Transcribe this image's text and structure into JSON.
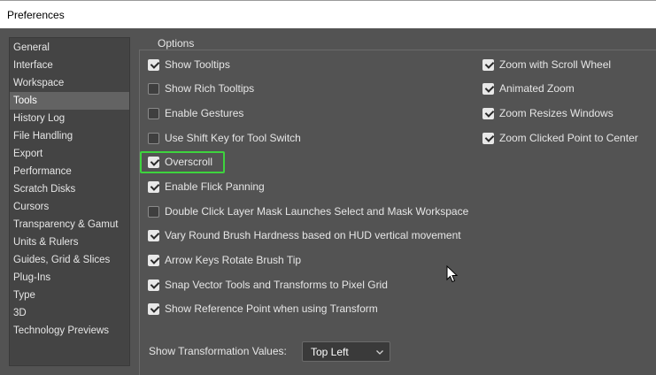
{
  "window": {
    "title": "Preferences"
  },
  "sidebar": {
    "items": [
      {
        "label": "General"
      },
      {
        "label": "Interface"
      },
      {
        "label": "Workspace"
      },
      {
        "label": "Tools",
        "active": true
      },
      {
        "label": "History Log"
      },
      {
        "label": "File Handling"
      },
      {
        "label": "Export"
      },
      {
        "label": "Performance"
      },
      {
        "label": "Scratch Disks"
      },
      {
        "label": "Cursors"
      },
      {
        "label": "Transparency & Gamut"
      },
      {
        "label": "Units & Rulers"
      },
      {
        "label": "Guides, Grid & Slices"
      },
      {
        "label": "Plug-Ins"
      },
      {
        "label": "Type"
      },
      {
        "label": "3D"
      },
      {
        "label": "Technology Previews"
      }
    ]
  },
  "options": {
    "legend": "Options",
    "left": [
      {
        "label": "Show Tooltips",
        "checked": true
      },
      {
        "label": "Show Rich Tooltips",
        "checked": false
      },
      {
        "label": "Enable Gestures",
        "checked": false
      },
      {
        "label": "Use Shift Key for Tool Switch",
        "checked": false
      },
      {
        "label": "Overscroll",
        "checked": true
      },
      {
        "label": "Enable Flick Panning",
        "checked": true
      },
      {
        "label": "Double Click Layer Mask Launches Select and Mask Workspace",
        "checked": false
      },
      {
        "label": "Vary Round Brush Hardness based on HUD vertical movement",
        "checked": true
      },
      {
        "label": "Arrow Keys Rotate Brush Tip",
        "checked": true
      },
      {
        "label": "Snap Vector Tools and Transforms to Pixel Grid",
        "checked": true
      },
      {
        "label": "Show Reference Point when using Transform",
        "checked": true
      }
    ],
    "right": [
      {
        "label": "Zoom with Scroll Wheel",
        "checked": true
      },
      {
        "label": "Animated Zoom",
        "checked": true
      },
      {
        "label": "Zoom Resizes Windows",
        "checked": true
      },
      {
        "label": "Zoom Clicked Point to Center",
        "checked": true
      }
    ]
  },
  "transform": {
    "label": "Show Transformation Values:",
    "selected": "Top Left"
  },
  "colors": {
    "focus_ring": "#3ed43e",
    "panel_bg": "#535353",
    "sidebar_bg": "#444444",
    "selected_bg": "#636363"
  }
}
